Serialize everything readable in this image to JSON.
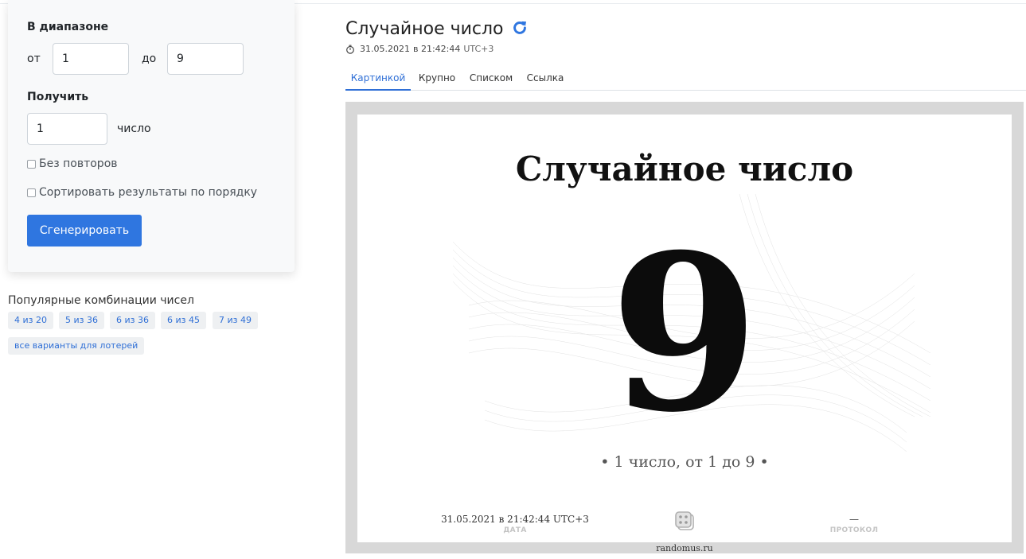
{
  "form": {
    "range_label": "В диапазоне",
    "from_label": "от",
    "from_value": "1",
    "to_label": "до",
    "to_value": "9",
    "get_label": "Получить",
    "count_value": "1",
    "count_unit": "число",
    "no_repeat_label": "Без повторов",
    "sort_label": "Сортировать результаты по порядку",
    "generate_label": "Сгенерировать"
  },
  "popular": {
    "title": "Популярные комбинации чисел",
    "items": [
      "4 из 20",
      "5 из 36",
      "6 из 36",
      "6 из 45",
      "7 из 49"
    ],
    "all_label": "все варианты для лотерей"
  },
  "header": {
    "title": "Случайное число",
    "date": "31.05.2021",
    "at": "в 21:42:44",
    "tz": "UTC+3"
  },
  "tabs": [
    "Картинкой",
    "Крупно",
    "Списком",
    "Ссылка"
  ],
  "result": {
    "title": "Случайное число",
    "number": "9",
    "caption": "•  1 число, от 1 до 9  •",
    "date_value": "31.05.2021 в 21:42:44 UTC+3",
    "date_label": "ДАТА",
    "protocol_value": "—",
    "protocol_label": "ПРОТОКОЛ",
    "site": "randomus.ru"
  },
  "colors": {
    "accent": "#2f76e0",
    "link": "#2f6fd6",
    "frame": "#d8d8d8"
  },
  "icons": [
    "refresh-icon",
    "clock-icon",
    "dice-icon"
  ]
}
